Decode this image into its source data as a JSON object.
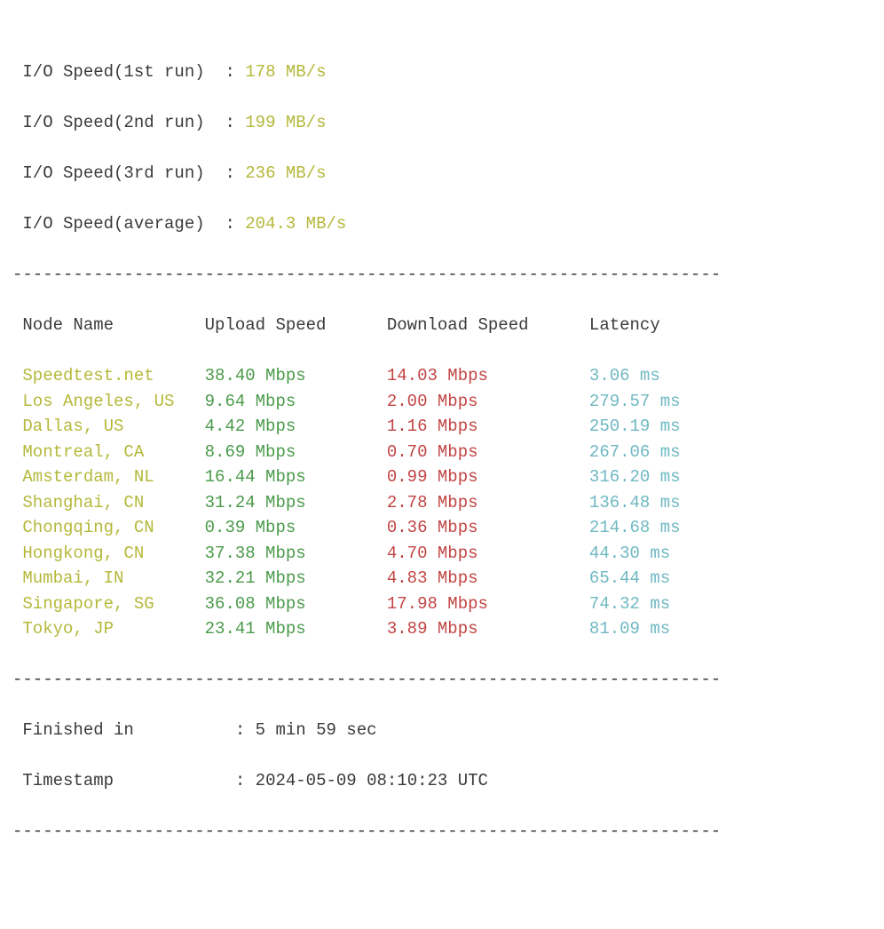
{
  "io": {
    "run1": {
      "label": " I/O Speed(1st run) ",
      "value": "178 MB/s"
    },
    "run2": {
      "label": " I/O Speed(2nd run) ",
      "value": "199 MB/s"
    },
    "run3": {
      "label": " I/O Speed(3rd run) ",
      "value": "236 MB/s"
    },
    "avg": {
      "label": " I/O Speed(average) ",
      "value": "204.3 MB/s"
    }
  },
  "sep": {
    "colon": " : ",
    "dashes": "----------------------------------------------------------------------"
  },
  "headers": {
    "node": " Node Name         ",
    "upload": "Upload Speed      ",
    "download": "Download Speed      ",
    "latency": "Latency"
  },
  "rows": [
    {
      "node": " Speedtest.net     ",
      "upload": "38.40 Mbps        ",
      "download": "14.03 Mbps          ",
      "latency": "3.06 ms"
    },
    {
      "node": " Los Angeles, US   ",
      "upload": "9.64 Mbps         ",
      "download": "2.00 Mbps           ",
      "latency": "279.57 ms"
    },
    {
      "node": " Dallas, US        ",
      "upload": "4.42 Mbps         ",
      "download": "1.16 Mbps           ",
      "latency": "250.19 ms"
    },
    {
      "node": " Montreal, CA      ",
      "upload": "8.69 Mbps         ",
      "download": "0.70 Mbps           ",
      "latency": "267.06 ms"
    },
    {
      "node": " Amsterdam, NL     ",
      "upload": "16.44 Mbps        ",
      "download": "0.99 Mbps           ",
      "latency": "316.20 ms"
    },
    {
      "node": " Shanghai, CN      ",
      "upload": "31.24 Mbps        ",
      "download": "2.78 Mbps           ",
      "latency": "136.48 ms"
    },
    {
      "node": " Chongqing, CN     ",
      "upload": "0.39 Mbps         ",
      "download": "0.36 Mbps           ",
      "latency": "214.68 ms"
    },
    {
      "node": " Hongkong, CN      ",
      "upload": "37.38 Mbps        ",
      "download": "4.70 Mbps           ",
      "latency": "44.30 ms"
    },
    {
      "node": " Mumbai, IN        ",
      "upload": "32.21 Mbps        ",
      "download": "4.83 Mbps           ",
      "latency": "65.44 ms"
    },
    {
      "node": " Singapore, SG     ",
      "upload": "36.08 Mbps        ",
      "download": "17.98 Mbps          ",
      "latency": "74.32 ms"
    },
    {
      "node": " Tokyo, JP         ",
      "upload": "23.41 Mbps        ",
      "download": "3.89 Mbps           ",
      "latency": "81.09 ms"
    }
  ],
  "footer": {
    "finished_label": " Finished in         ",
    "finished_value": "5 min 59 sec",
    "timestamp_label": " Timestamp           ",
    "timestamp_value": "2024-05-09 08:10:23 UTC"
  },
  "chart_data": {
    "type": "table",
    "columns": [
      "Node Name",
      "Upload Speed (Mbps)",
      "Download Speed (Mbps)",
      "Latency (ms)"
    ],
    "rows": [
      [
        "Speedtest.net",
        38.4,
        14.03,
        3.06
      ],
      [
        "Los Angeles, US",
        9.64,
        2.0,
        279.57
      ],
      [
        "Dallas, US",
        4.42,
        1.16,
        250.19
      ],
      [
        "Montreal, CA",
        8.69,
        0.7,
        267.06
      ],
      [
        "Amsterdam, NL",
        16.44,
        0.99,
        316.2
      ],
      [
        "Shanghai, CN",
        31.24,
        2.78,
        136.48
      ],
      [
        "Chongqing, CN",
        0.39,
        0.36,
        214.68
      ],
      [
        "Hongkong, CN",
        37.38,
        4.7,
        44.3
      ],
      [
        "Mumbai, IN",
        32.21,
        4.83,
        65.44
      ],
      [
        "Singapore, SG",
        36.08,
        17.98,
        74.32
      ],
      [
        "Tokyo, JP",
        23.41,
        3.89,
        81.09
      ]
    ],
    "io_speed_mb_s": {
      "run1": 178,
      "run2": 199,
      "run3": 236,
      "average": 204.3
    },
    "finished_in": "5 min 59 sec",
    "timestamp": "2024-05-09 08:10:23 UTC"
  }
}
